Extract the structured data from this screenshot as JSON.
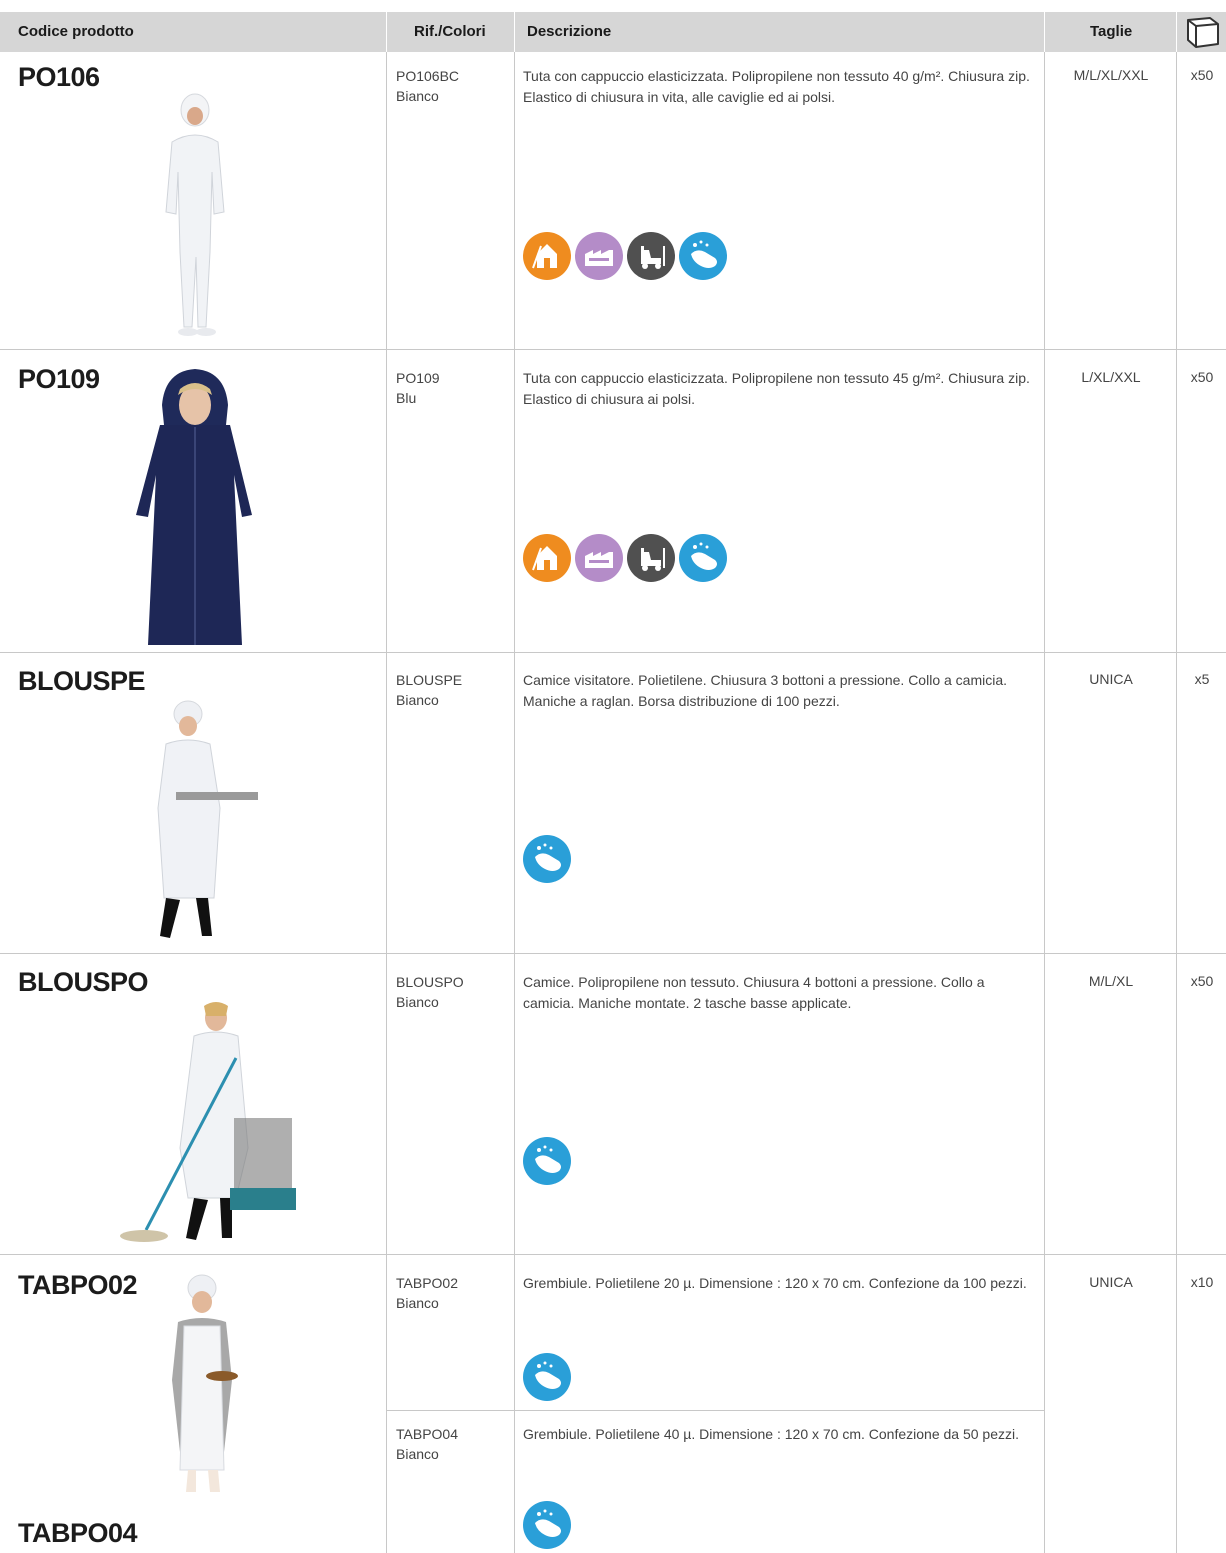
{
  "header": {
    "code": "Codice prodotto",
    "ref": "Rif./Colori",
    "desc": "Descrizione",
    "sizes": "Taglie",
    "box_icon": "box-icon"
  },
  "colors": {
    "header_bg": "#d6d6d6",
    "orange": "#ef8c1f",
    "purple": "#b48cc8",
    "dark": "#505050",
    "blue": "#2a9fd8"
  },
  "rows": [
    {
      "code": "PO106",
      "ref_code": "PO106BC",
      "ref_color": "Bianco",
      "desc": "Tuta con cappuccio elasticizzata. Polipropilene non tessuto 40 g/m². Chiusura zip. Elastico di chiusura in vita, alle caviglie ed ai polsi.",
      "sizes": "M/L/XL/XXL",
      "qty": "x50",
      "icons": [
        "building-icon",
        "factory-icon",
        "forklift-icon",
        "hand-wash-icon"
      ]
    },
    {
      "code": "PO109",
      "ref_code": "PO109",
      "ref_color": "Blu",
      "desc": "Tuta con cappuccio elasticizzata. Polipropilene non tessuto 45 g/m². Chiusura zip. Elastico di chiusura ai polsi.",
      "sizes": "L/XL/XXL",
      "qty": "x50",
      "icons": [
        "building-icon",
        "factory-icon",
        "forklift-icon",
        "hand-wash-icon"
      ]
    },
    {
      "code": "BLOUSPE",
      "ref_code": "BLOUSPE",
      "ref_color": "Bianco",
      "desc": "Camice visitatore. Polietilene. Chiusura 3 bottoni a pressione. Collo a camicia. Maniche a raglan. Borsa distribuzione di 100 pezzi.",
      "sizes": "UNICA",
      "qty": "x5",
      "icons": [
        "hand-wash-icon"
      ]
    },
    {
      "code": "BLOUSPO",
      "ref_code": "BLOUSPO",
      "ref_color": "Bianco",
      "desc": "Camice. Polipropilene non tessuto. Chiusura 4 bottoni a pressione. Collo a camicia. Maniche montate. 2 tasche basse applicate.",
      "sizes": "M/L/XL",
      "qty": "x50",
      "icons": [
        "hand-wash-icon"
      ]
    },
    {
      "code": "TABPO02",
      "ref_code": "TABPO02",
      "ref_color": "Bianco",
      "desc": "Grembiule. Polietilene 20 µ. Dimensione : 120 x 70 cm. Confezione da 100 pezzi.",
      "sizes": "UNICA",
      "qty": "x10",
      "icons": [
        "hand-wash-icon"
      ]
    },
    {
      "code": "TABPO04",
      "ref_code": "TABPO04",
      "ref_color": "Bianco",
      "desc": "Grembiule. Polietilene 40 µ. Dimensione : 120 x 70 cm. Confezione da 50 pezzi.",
      "icons": [
        "hand-wash-icon"
      ]
    }
  ]
}
